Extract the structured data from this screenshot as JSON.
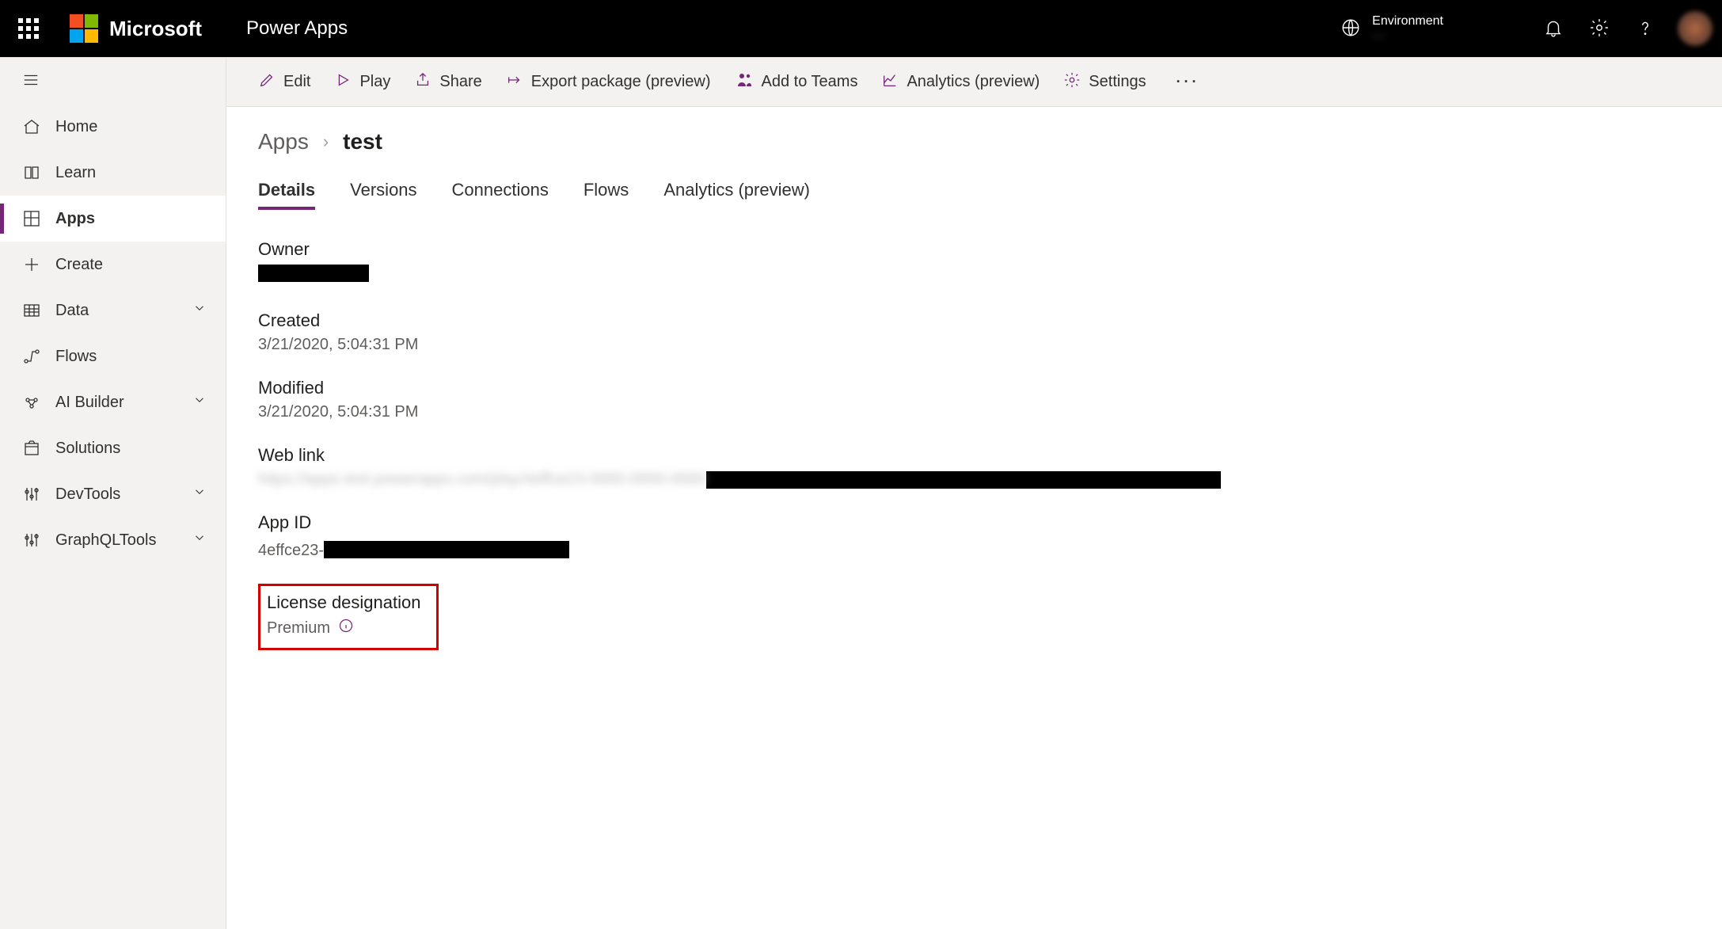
{
  "topbar": {
    "microsoft": "Microsoft",
    "app_name": "Power Apps",
    "environment_label": "Environment",
    "environment_name": "—"
  },
  "nav": {
    "items": [
      {
        "label": "Home"
      },
      {
        "label": "Learn"
      },
      {
        "label": "Apps"
      },
      {
        "label": "Create"
      },
      {
        "label": "Data"
      },
      {
        "label": "Flows"
      },
      {
        "label": "AI Builder"
      },
      {
        "label": "Solutions"
      },
      {
        "label": "DevTools"
      },
      {
        "label": "GraphQLTools"
      }
    ]
  },
  "cmdbar": {
    "edit": "Edit",
    "play": "Play",
    "share": "Share",
    "export": "Export package (preview)",
    "teams": "Add to Teams",
    "analytics": "Analytics (preview)",
    "settings": "Settings"
  },
  "breadcrumb": {
    "root": "Apps",
    "current": "test"
  },
  "tabs": [
    {
      "label": "Details"
    },
    {
      "label": "Versions"
    },
    {
      "label": "Connections"
    },
    {
      "label": "Flows"
    },
    {
      "label": "Analytics (preview)"
    }
  ],
  "details": {
    "owner_label": "Owner",
    "created_label": "Created",
    "created_value": "3/21/2020, 5:04:31 PM",
    "modified_label": "Modified",
    "modified_value": "3/21/2020, 5:04:31 PM",
    "weblink_label": "Web link",
    "weblink_value_blurred": "https://apps.test.powerapps.com/play/4effce23-0000-0000-0000",
    "appid_label": "App ID",
    "appid_prefix": "4effce23-",
    "license_label": "License designation",
    "license_value": "Premium"
  }
}
